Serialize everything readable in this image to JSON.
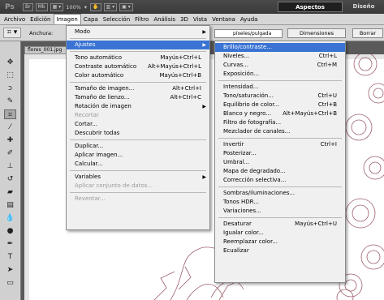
{
  "app": {
    "logo": "Ps",
    "br": "Br",
    "mb": "Mb",
    "zoom": "100%",
    "workspace": "Aspectos esenciales",
    "design": "Diseño"
  },
  "menubar": [
    "Archivo",
    "Edición",
    "Imagen",
    "Capa",
    "Selección",
    "Filtro",
    "Análisis",
    "3D",
    "Vista",
    "Ventana",
    "Ayuda"
  ],
  "options": {
    "width_label": "Anchura:",
    "units": "píxeles/pulgada",
    "dims_button": "Dimensiones",
    "clear_button": "Borrar"
  },
  "document": {
    "tab": "flores_001.jpg"
  },
  "imagen_menu": [
    {
      "label": "Modo",
      "sub": true
    },
    {
      "sep": true
    },
    {
      "label": "Ajustes",
      "sub": true,
      "hl": true
    },
    {
      "sep": true
    },
    {
      "label": "Tono automático",
      "sc": "Mayús+Ctrl+L"
    },
    {
      "label": "Contraste automático",
      "sc": "Alt+Mayús+Ctrl+L"
    },
    {
      "label": "Color automático",
      "sc": "Mayús+Ctrl+B"
    },
    {
      "sep": true
    },
    {
      "label": "Tamaño de imagen...",
      "sc": "Alt+Ctrl+I"
    },
    {
      "label": "Tamaño de lienzo...",
      "sc": "Alt+Ctrl+C"
    },
    {
      "label": "Rotación de imagen",
      "sub": true
    },
    {
      "label": "Recortar",
      "dis": true
    },
    {
      "label": "Cortar..."
    },
    {
      "label": "Descubrir todas"
    },
    {
      "sep": true
    },
    {
      "label": "Duplicar..."
    },
    {
      "label": "Aplicar imagen..."
    },
    {
      "label": "Calcular..."
    },
    {
      "sep": true
    },
    {
      "label": "Variables",
      "sub": true
    },
    {
      "label": "Aplicar conjunto de datos...",
      "dis": true
    },
    {
      "sep": true
    },
    {
      "label": "Reventar...",
      "dis": true
    }
  ],
  "ajustes_menu": [
    {
      "label": "Brillo/contraste...",
      "hl": true
    },
    {
      "label": "Niveles...",
      "sc": "Ctrl+L"
    },
    {
      "label": "Curvas...",
      "sc": "Ctrl+M"
    },
    {
      "label": "Exposición..."
    },
    {
      "sep": true
    },
    {
      "label": "Intensidad..."
    },
    {
      "label": "Tono/saturación...",
      "sc": "Ctrl+U"
    },
    {
      "label": "Equilibrio de color...",
      "sc": "Ctrl+B"
    },
    {
      "label": "Blanco y negro...",
      "sc": "Alt+Mayús+Ctrl+B"
    },
    {
      "label": "Filtro de fotografía..."
    },
    {
      "label": "Mezclador de canales..."
    },
    {
      "sep": true
    },
    {
      "label": "Invertir",
      "sc": "Ctrl+I"
    },
    {
      "label": "Posterizar..."
    },
    {
      "label": "Umbral..."
    },
    {
      "label": "Mapa de degradado..."
    },
    {
      "label": "Corrección selectiva..."
    },
    {
      "sep": true
    },
    {
      "label": "Sombras/iluminaciones..."
    },
    {
      "label": "Tonos HDR..."
    },
    {
      "label": "Variaciones..."
    },
    {
      "sep": true
    },
    {
      "label": "Desaturar",
      "sc": "Mayús+Ctrl+U"
    },
    {
      "label": "Igualar color..."
    },
    {
      "label": "Reemplazar color..."
    },
    {
      "label": "Ecualizar"
    }
  ],
  "colors": {
    "highlight": "#3a73d3",
    "app_bar": "#3f3f3f",
    "menu_bg": "#f0f0f0",
    "ink": "#7a2a3a"
  }
}
